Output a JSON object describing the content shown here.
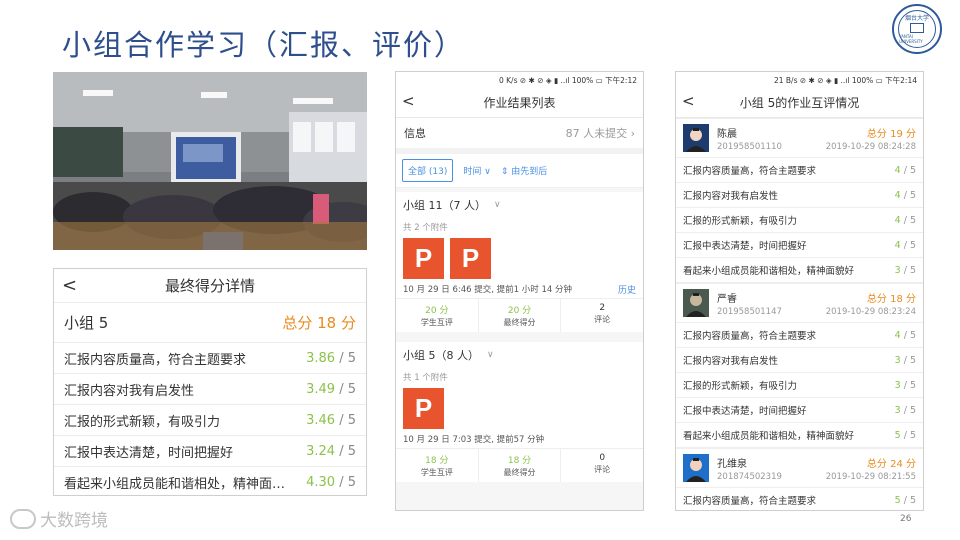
{
  "title": "小组合作学习（汇报、评价）",
  "logo": {
    "top": "烟台大学",
    "bottom": "YANTAI UNIVERSITY"
  },
  "score_detail": {
    "back": "<",
    "title": "最终得分详情",
    "group": "小组 5",
    "total": "总分 18 分",
    "rows": [
      {
        "criterion": "汇报内容质量高，符合主题要求",
        "score": "3.86",
        "max": "/ 5"
      },
      {
        "criterion": "汇报内容对我有启发性",
        "score": "3.49",
        "max": "/ 5"
      },
      {
        "criterion": "汇报的形式新颖，有吸引力",
        "score": "3.46",
        "max": "/ 5"
      },
      {
        "criterion": "汇报中表达清楚，时间把握好",
        "score": "3.24",
        "max": "/ 5"
      },
      {
        "criterion": "看起来小组成员能和谐相处，精神面…",
        "score": "4.30",
        "max": "/ 5"
      }
    ]
  },
  "results_list": {
    "status": "0 K/s ⊘ ✱ ⊘ ◈ ▮ ..ıl 100% ▭ 下午2:12",
    "back": "<",
    "title": "作业结果列表",
    "info_label": "信息",
    "info_count": "87 人未提交",
    "filter_all": "全部 (13)",
    "filter_time": "时间",
    "filter_sort": "由先到后",
    "groups": [
      {
        "name": "小组 11（7 人）",
        "attachments": "共 2 个附件",
        "ppt_count": 2,
        "submit": "10 月 29 日 6:46 提交, 提前1 小时 14 分钟",
        "history": "历史",
        "stats": [
          {
            "value": "20 分",
            "label": "学生互评"
          },
          {
            "value": "20 分",
            "label": "最终得分"
          },
          {
            "value": "2",
            "label": "评论"
          }
        ]
      },
      {
        "name": "小组 5（8 人）",
        "attachments": "共 1 个附件",
        "ppt_count": 1,
        "submit": "10 月 29 日 7:03 提交, 提前57 分钟",
        "history": "",
        "stats": [
          {
            "value": "18 分",
            "label": "学生互评"
          },
          {
            "value": "18 分",
            "label": "最终得分"
          },
          {
            "value": "0",
            "label": "评论"
          }
        ]
      }
    ]
  },
  "peer_review": {
    "status": "21 B/s ⊘ ✱ ⊘ ◈ ▮ ..ıl 100% ▭ 下午2:14",
    "back": "<",
    "title": "小组 5的作业互评情况",
    "members": [
      {
        "name": "陈晨",
        "id": "201958501110",
        "total": "总分 19 分",
        "time": "2019-10-29 08:24:28",
        "rows": [
          {
            "criterion": "汇报内容质量高，符合主题要求",
            "score": "4",
            "max": "/ 5"
          },
          {
            "criterion": "汇报内容对我有启发性",
            "score": "4",
            "max": "/ 5"
          },
          {
            "criterion": "汇报的形式新颖，有吸引力",
            "score": "4",
            "max": "/ 5"
          },
          {
            "criterion": "汇报中表达清楚，时间把握好",
            "score": "4",
            "max": "/ 5"
          },
          {
            "criterion": "看起来小组成员能和谐相处，精神面貌好",
            "score": "3",
            "max": "/ 5"
          }
        ]
      },
      {
        "name": "严睿",
        "id": "201958501147",
        "total": "总分 18 分",
        "time": "2019-10-29 08:23:24",
        "rows": [
          {
            "criterion": "汇报内容质量高，符合主题要求",
            "score": "4",
            "max": "/ 5"
          },
          {
            "criterion": "汇报内容对我有启发性",
            "score": "3",
            "max": "/ 5"
          },
          {
            "criterion": "汇报的形式新颖，有吸引力",
            "score": "3",
            "max": "/ 5"
          },
          {
            "criterion": "汇报中表达清楚，时间把握好",
            "score": "3",
            "max": "/ 5"
          },
          {
            "criterion": "看起来小组成员能和谐相处，精神面貌好",
            "score": "5",
            "max": "/ 5"
          }
        ]
      },
      {
        "name": "孔维泉",
        "id": "201874502319",
        "total": "总分 24 分",
        "time": "2019-10-29 08:21:55",
        "rows": [
          {
            "criterion": "汇报内容质量高，符合主题要求",
            "score": "5",
            "max": "/ 5"
          }
        ]
      }
    ]
  },
  "brand": "大数跨境",
  "page_number": "26",
  "colors": {
    "title": "#2e4f8c",
    "accent_orange": "#e98b1f",
    "score_green": "#8cc24a",
    "link_blue": "#4a90e2",
    "ppt_orange": "#e8542d"
  }
}
